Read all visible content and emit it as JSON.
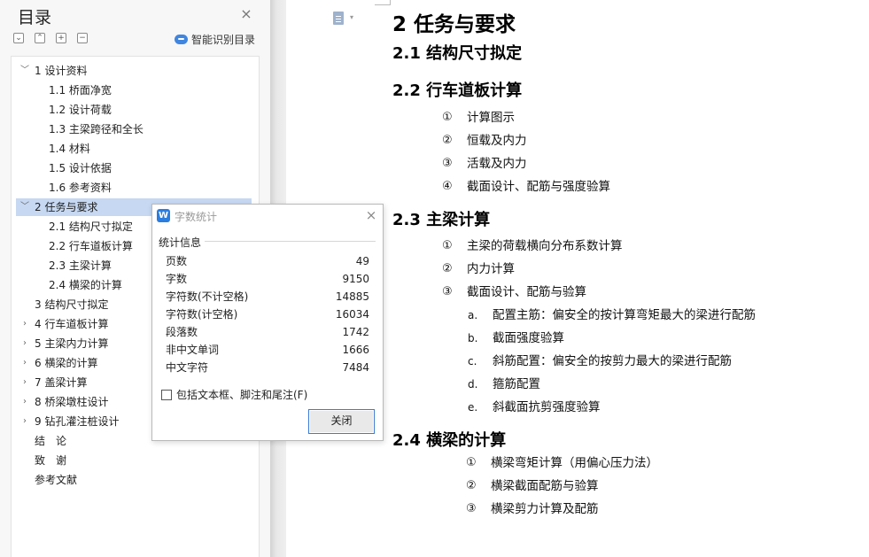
{
  "nav": {
    "title": "目录",
    "close_glyph": "×",
    "tools": [
      {
        "icon": "collapse-all-icon",
        "glyph": "⌄"
      },
      {
        "icon": "expand-all-icon",
        "glyph": "⌃"
      },
      {
        "icon": "add-icon",
        "glyph": "+"
      },
      {
        "icon": "remove-icon",
        "glyph": "−"
      }
    ],
    "smart_label": "智能识别目录",
    "toc": [
      {
        "label": "1 设计资料",
        "level": 1,
        "arrow": "﹀"
      },
      {
        "label": "1.1 桥面净宽",
        "level": 2
      },
      {
        "label": "1.2 设计荷载",
        "level": 2
      },
      {
        "label": "1.3 主梁跨径和全长",
        "level": 2
      },
      {
        "label": "1.4 材料",
        "level": 2
      },
      {
        "label": "1.5 设计依据",
        "level": 2
      },
      {
        "label": "1.6 参考资料",
        "level": 2
      },
      {
        "label": "2 任务与要求",
        "level": 1,
        "arrow": "﹀",
        "selected": true
      },
      {
        "label": "2.1 结构尺寸拟定",
        "level": 2
      },
      {
        "label": "2.2 行车道板计算",
        "level": 2
      },
      {
        "label": "2.3 主梁计算",
        "level": 2
      },
      {
        "label": "2.4 横梁的计算",
        "level": 2
      },
      {
        "label": "3 结构尺寸拟定",
        "level": 1
      },
      {
        "label": "4 行车道板计算",
        "level": 1,
        "arrow": "›"
      },
      {
        "label": "5 主梁内力计算",
        "level": 1,
        "arrow": "›"
      },
      {
        "label": "6  横梁的计算",
        "level": 1,
        "arrow": "›"
      },
      {
        "label": "7  盖梁计算",
        "level": 1,
        "arrow": "›"
      },
      {
        "label": "8  桥梁墩柱设计",
        "level": 1,
        "arrow": "›"
      },
      {
        "label": "9  钻孔灌注桩设计",
        "level": 1,
        "arrow": "›"
      },
      {
        "label": "结　论",
        "level": 1
      },
      {
        "label": "致　谢",
        "level": 1
      },
      {
        "label": "参考文献",
        "level": 1
      }
    ]
  },
  "document": {
    "doc_menu_arrow": "▾",
    "heading": "2 任务与要求",
    "sections": [
      {
        "title": "2.1 结构尺寸拟定",
        "items": []
      },
      {
        "title": "2.2 行车道板计算",
        "items": [
          {
            "num": "①",
            "text": "计算图示"
          },
          {
            "num": "②",
            "text": "恒载及内力"
          },
          {
            "num": "③",
            "text": "活载及内力"
          },
          {
            "num": "④",
            "text": "截面设计、配筋与强度验算"
          }
        ]
      },
      {
        "title": "2.3 主梁计算",
        "items": [
          {
            "num": "①",
            "text": "主梁的荷载横向分布系数计算"
          },
          {
            "num": "②",
            "text": "内力计算"
          },
          {
            "num": "③",
            "text": "截面设计、配筋与验算"
          }
        ],
        "subitems": [
          {
            "num": "a.",
            "text": "配置主筋：偏安全的按计算弯矩最大的梁进行配筋"
          },
          {
            "num": "b.",
            "text": "截面强度验算"
          },
          {
            "num": "c.",
            "text": "斜筋配置：偏安全的按剪力最大的梁进行配筋"
          },
          {
            "num": "d.",
            "text": "箍筋配置"
          },
          {
            "num": "e.",
            "text": "斜截面抗剪强度验算"
          }
        ]
      },
      {
        "title": "2.4 横梁的计算",
        "items": [
          {
            "num": "①",
            "text": "横梁弯矩计算（用偏心压力法）"
          },
          {
            "num": "②",
            "text": "横梁截面配筋与验算"
          },
          {
            "num": "③",
            "text": "横梁剪力计算及配筋"
          }
        ]
      }
    ]
  },
  "word_count": {
    "logo": "W",
    "title": "字数统计",
    "close_glyph": "×",
    "section": "统计信息",
    "rows": [
      {
        "label": "页数",
        "value": "49"
      },
      {
        "label": "字数",
        "value": "9150"
      },
      {
        "label": "字符数(不计空格)",
        "value": "14885"
      },
      {
        "label": "字符数(计空格)",
        "value": "16034"
      },
      {
        "label": "段落数",
        "value": "1742"
      },
      {
        "label": "非中文单词",
        "value": "1666"
      },
      {
        "label": "中文字符",
        "value": "7484"
      }
    ],
    "checkbox_label": "包括文本框、脚注和尾注(F)",
    "checkbox_checked": false,
    "close_button": "关闭"
  }
}
